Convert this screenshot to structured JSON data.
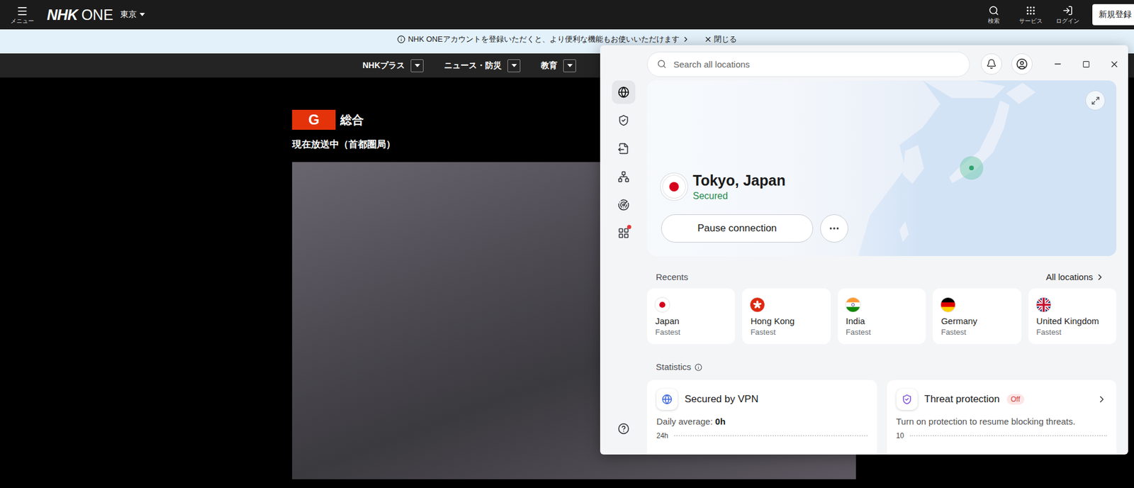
{
  "page": {
    "header": {
      "menu_label": "メニュー",
      "logo": {
        "brand": "NHK",
        "product": "ONE"
      },
      "region": "東京",
      "actions": [
        {
          "label": "検索"
        },
        {
          "label": "サービス"
        },
        {
          "label": "ログイン"
        }
      ],
      "signup": "新規登録"
    },
    "notice": {
      "text": "NHK ONEアカウントを登録いただくと、より便利な機能もお使いいただけます",
      "close": "閉じる"
    },
    "nav": [
      {
        "label": "NHKプラス"
      },
      {
        "label": "ニュース・防災"
      },
      {
        "label": "教育"
      }
    ],
    "channel": {
      "badge": "G",
      "name": "総合",
      "status": "現在放送中（首都圏局）"
    }
  },
  "vpn": {
    "search": {
      "placeholder": "Search all locations"
    },
    "sidebar": {
      "items": [
        {
          "selected": true,
          "alert": false
        },
        {
          "selected": false,
          "alert": false
        },
        {
          "selected": false,
          "alert": false
        },
        {
          "selected": false,
          "alert": false
        },
        {
          "selected": false,
          "alert": false
        },
        {
          "selected": false,
          "alert": true
        }
      ]
    },
    "connection": {
      "location": "Tokyo, Japan",
      "status": "Secured",
      "pause": "Pause connection"
    },
    "recents": {
      "title": "Recents",
      "all": "All locations",
      "items": [
        {
          "name": "Japan",
          "detail": "Fastest"
        },
        {
          "name": "Hong Kong",
          "detail": "Fastest"
        },
        {
          "name": "India",
          "detail": "Fastest"
        },
        {
          "name": "Germany",
          "detail": "Fastest"
        },
        {
          "name": "United Kingdom",
          "detail": "Fastest"
        }
      ]
    },
    "statistics": {
      "title": "Statistics",
      "cards": [
        {
          "kind": "vpn",
          "title": "Secured by VPN",
          "label": "Daily average:",
          "value": "0h",
          "axis": "24h"
        },
        {
          "kind": "threat",
          "title": "Threat protection",
          "badge": "Off",
          "text": "Turn on protection to resume blocking threats.",
          "axis": "10"
        }
      ]
    }
  }
}
